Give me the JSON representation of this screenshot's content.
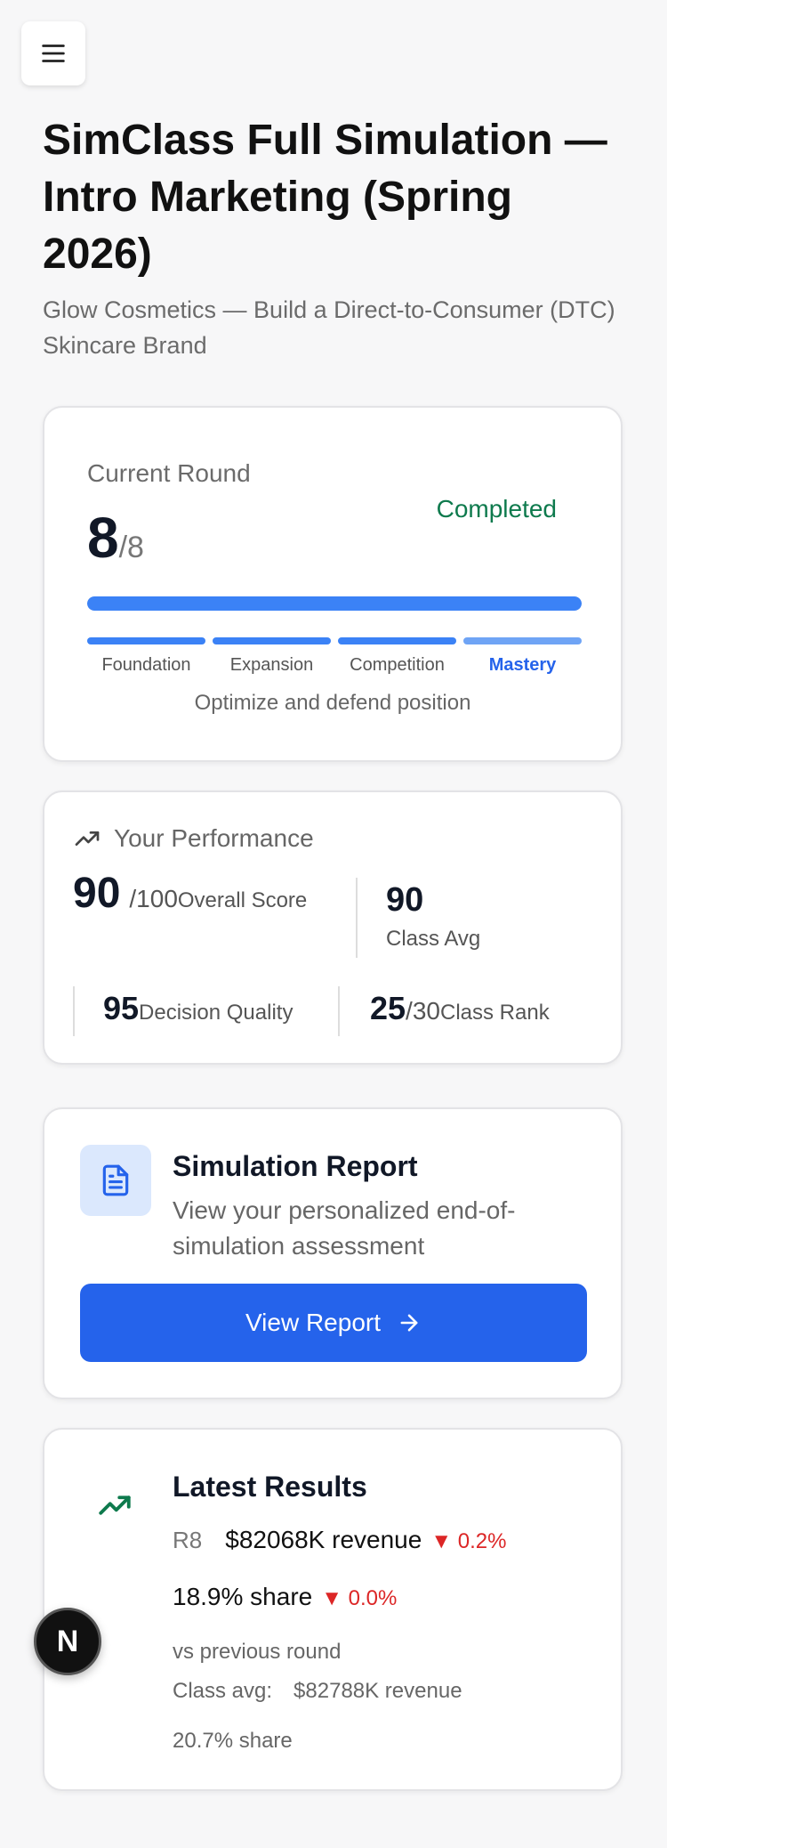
{
  "header": {
    "menu_icon": "menu-icon",
    "title": "SimClass Full Simulation — Intro Marketing (Spring 2026)",
    "subtitle": "Glow Cosmetics — Build a Direct-to-Consumer (DTC) Skincare Brand"
  },
  "round": {
    "label": "Current Round",
    "current": "8",
    "total": "/8",
    "status": "Completed",
    "progress": 1.0,
    "phases": [
      {
        "label": "Foundation",
        "active": false
      },
      {
        "label": "Expansion",
        "active": false
      },
      {
        "label": "Competition",
        "active": false
      },
      {
        "label": "Mastery",
        "active": true
      }
    ],
    "phase_description": "Optimize and defend position"
  },
  "performance": {
    "heading": "Your Performance",
    "overall_score": "90",
    "overall_max": "/100",
    "overall_label": "Overall Score",
    "class_avg": "90",
    "class_avg_label": "Class Avg",
    "decision_quality": "95",
    "decision_quality_label": "Decision Quality",
    "class_rank": "25",
    "class_rank_total": "/30",
    "class_rank_label": "Class Rank"
  },
  "report": {
    "title": "Simulation Report",
    "description": "View your personalized end-of-simulation assessment",
    "button_label": "View Report"
  },
  "results": {
    "title": "Latest Results",
    "round_tag": "R8",
    "revenue": "$82068K revenue",
    "revenue_change": "▼ 0.2%",
    "share": "18.9% share",
    "share_change": "▼ 0.0%",
    "comparison_note": "vs previous round",
    "class_avg_label": "Class avg:",
    "class_avg_revenue": "$82788K revenue",
    "class_avg_share": "20.7% share"
  },
  "badge": {
    "letter": "N"
  },
  "colors": {
    "accent": "#2563eb",
    "success": "#0e7a4d",
    "negative": "#dc2626"
  }
}
